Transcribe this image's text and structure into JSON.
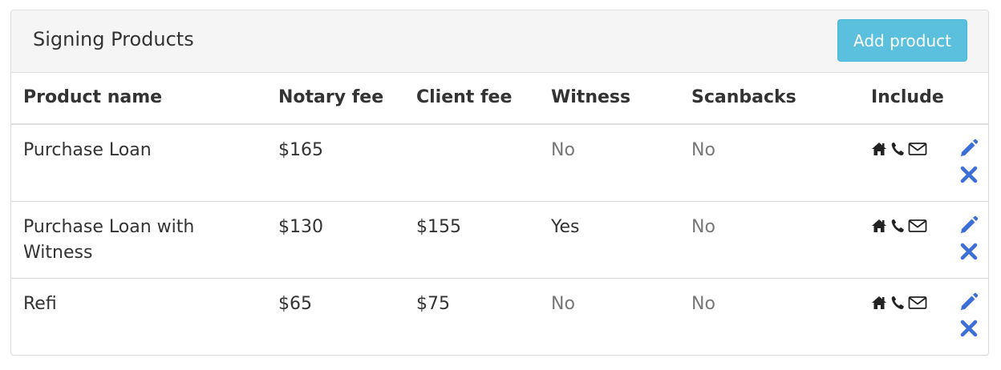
{
  "panel": {
    "title": "Signing Products",
    "add_button_label": "Add product"
  },
  "table": {
    "headers": {
      "product_name": "Product name",
      "notary_fee": "Notary fee",
      "client_fee": "Client fee",
      "witness": "Witness",
      "scanbacks": "Scanbacks",
      "include": "Include"
    },
    "rows": [
      {
        "product_name": "Purchase Loan",
        "notary_fee": "$165",
        "client_fee": "",
        "witness": "No",
        "scanbacks": "No",
        "include_icons": [
          "home-icon",
          "phone-icon",
          "envelope-icon"
        ]
      },
      {
        "product_name": "Purchase Loan with Witness",
        "notary_fee": "$130",
        "client_fee": "$155",
        "witness": "Yes",
        "scanbacks": "No",
        "include_icons": [
          "home-icon",
          "phone-icon",
          "envelope-icon"
        ]
      },
      {
        "product_name": "Refi",
        "notary_fee": "$65",
        "client_fee": "$75",
        "witness": "No",
        "scanbacks": "No",
        "include_icons": [
          "home-icon",
          "phone-icon",
          "envelope-icon"
        ]
      }
    ]
  },
  "colors": {
    "accent_button": "#5bc0de",
    "action_icons": "#3c6fd6",
    "muted_text": "#777777"
  }
}
